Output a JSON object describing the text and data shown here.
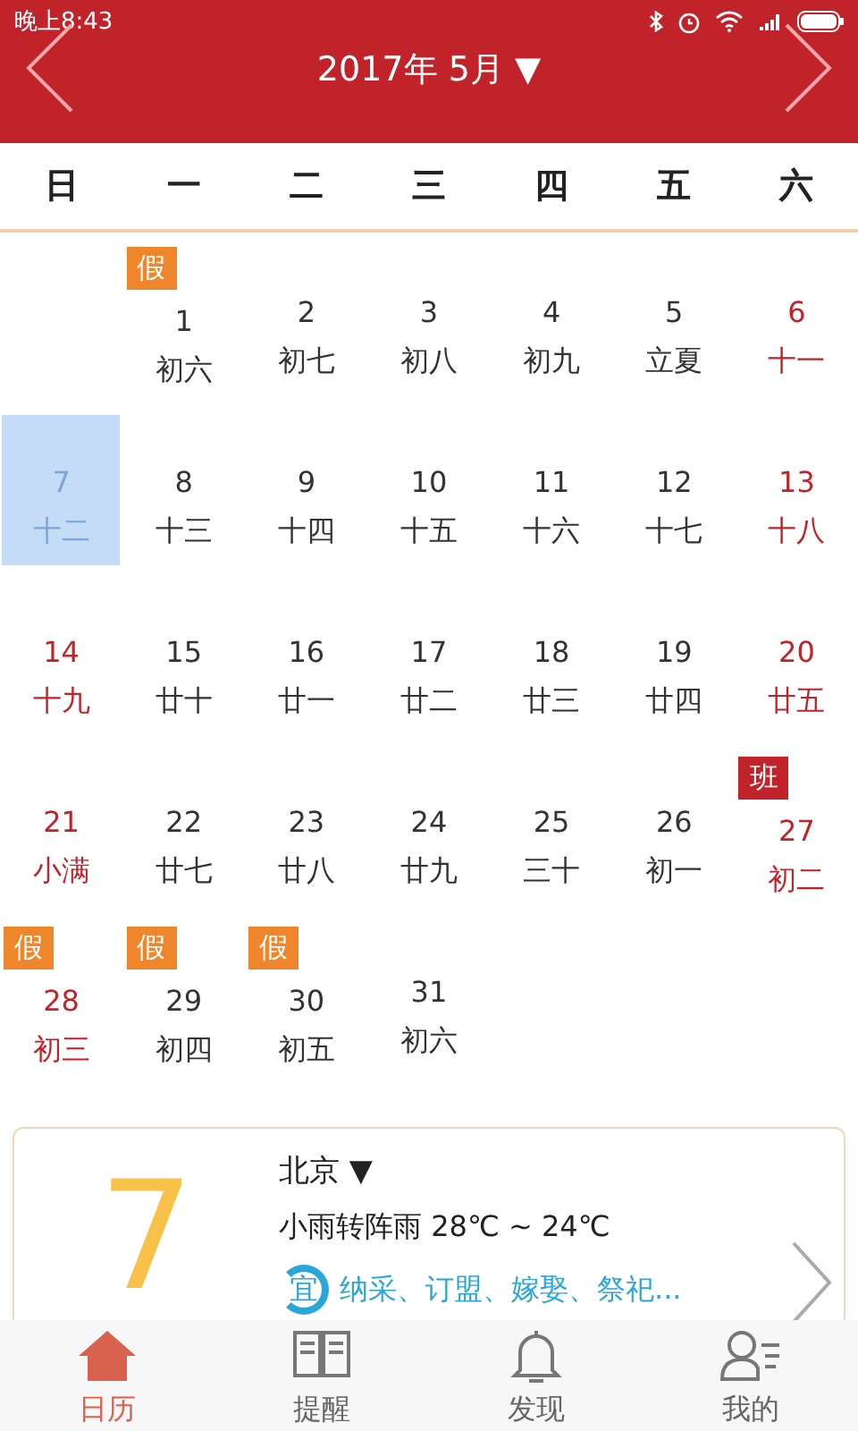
{
  "status_bar": {
    "time": "晚上8:43"
  },
  "header": {
    "title": "2017年 5月 ▼"
  },
  "weekdays": [
    "日",
    "一",
    "二",
    "三",
    "四",
    "五",
    "六"
  ],
  "weeks": [
    [
      {
        "kind": "empty"
      },
      {
        "kind": "day",
        "day": "1",
        "lunar": "初六",
        "selected": false,
        "badge": {
          "text": "假",
          "kind": "holiday"
        }
      },
      {
        "kind": "day",
        "day": "2",
        "lunar": "初七",
        "selected": false
      },
      {
        "kind": "day",
        "day": "3",
        "lunar": "初八",
        "selected": false
      },
      {
        "kind": "day",
        "day": "4",
        "lunar": "初九",
        "selected": false
      },
      {
        "kind": "day",
        "day": "5",
        "lunar": "立夏",
        "selected": false
      },
      {
        "kind": "day",
        "day": "6",
        "lunar": "十一",
        "selected": false
      }
    ],
    [
      {
        "kind": "day",
        "day": "7",
        "lunar": "十二",
        "selected": true
      },
      {
        "kind": "day",
        "day": "8",
        "lunar": "十三",
        "selected": false
      },
      {
        "kind": "day",
        "day": "9",
        "lunar": "十四",
        "selected": false
      },
      {
        "kind": "day",
        "day": "10",
        "lunar": "十五",
        "selected": false
      },
      {
        "kind": "day",
        "day": "11",
        "lunar": "十六",
        "selected": false
      },
      {
        "kind": "day",
        "day": "12",
        "lunar": "十七",
        "selected": false
      },
      {
        "kind": "day",
        "day": "13",
        "lunar": "十八",
        "selected": false
      }
    ],
    [
      {
        "kind": "day",
        "day": "14",
        "lunar": "十九",
        "selected": false
      },
      {
        "kind": "day",
        "day": "15",
        "lunar": "廿十",
        "selected": false
      },
      {
        "kind": "day",
        "day": "16",
        "lunar": "廿一",
        "selected": false
      },
      {
        "kind": "day",
        "day": "17",
        "lunar": "廿二",
        "selected": false
      },
      {
        "kind": "day",
        "day": "18",
        "lunar": "廿三",
        "selected": false
      },
      {
        "kind": "day",
        "day": "19",
        "lunar": "廿四",
        "selected": false
      },
      {
        "kind": "day",
        "day": "20",
        "lunar": "廿五",
        "selected": false
      }
    ],
    [
      {
        "kind": "day",
        "day": "21",
        "lunar": "小满",
        "selected": false
      },
      {
        "kind": "day",
        "day": "22",
        "lunar": "廿七",
        "selected": false
      },
      {
        "kind": "day",
        "day": "23",
        "lunar": "廿八",
        "selected": false
      },
      {
        "kind": "day",
        "day": "24",
        "lunar": "廿九",
        "selected": false
      },
      {
        "kind": "day",
        "day": "25",
        "lunar": "三十",
        "selected": false
      },
      {
        "kind": "day",
        "day": "26",
        "lunar": "初一",
        "selected": false
      },
      {
        "kind": "day",
        "day": "27",
        "lunar": "初二",
        "selected": false,
        "badge": {
          "text": "班",
          "kind": "workday"
        }
      }
    ],
    [
      {
        "kind": "day",
        "day": "28",
        "lunar": "初三",
        "selected": false,
        "badge": {
          "text": "假",
          "kind": "holiday"
        }
      },
      {
        "kind": "day",
        "day": "29",
        "lunar": "初四",
        "selected": false,
        "badge": {
          "text": "假",
          "kind": "holiday"
        }
      },
      {
        "kind": "day",
        "day": "30",
        "lunar": "初五",
        "selected": false,
        "badge": {
          "text": "假",
          "kind": "holiday"
        }
      },
      {
        "kind": "day",
        "day": "31",
        "lunar": "初六",
        "selected": false
      },
      {
        "kind": "empty"
      },
      {
        "kind": "empty"
      },
      {
        "kind": "empty"
      }
    ]
  ],
  "today_card": {
    "day": "7",
    "city": "北京 ▼",
    "weather": "小雨转阵雨 28℃ ~ 24℃",
    "yi_label": "宜",
    "yi_items": "纳采、订盟、嫁娶、祭祀..."
  },
  "tabs": [
    {
      "label": "日历",
      "selected": true
    },
    {
      "label": "提醒",
      "selected": false
    },
    {
      "label": "发现",
      "selected": false
    },
    {
      "label": "我的",
      "selected": false
    }
  ]
}
